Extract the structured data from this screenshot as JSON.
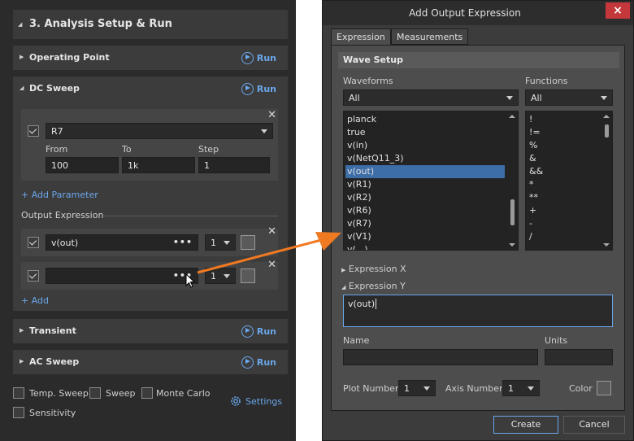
{
  "left": {
    "section_title": "3. Analysis Setup & Run",
    "run_label": "Run",
    "operating_point": {
      "title": "Operating Point"
    },
    "dc_sweep": {
      "title": "DC Sweep",
      "source_value": "R7",
      "from_label": "From",
      "to_label": "To",
      "step_label": "Step",
      "from_value": "100",
      "to_value": "1k",
      "step_value": "1",
      "add_parameter": "+ Add Parameter",
      "output_expression_label": "Output Expression",
      "expr1_value": "v(out)",
      "expr1_plot": "1",
      "expr2_value": "",
      "expr2_plot": "1",
      "add_label": "+ Add",
      "dots": "•••"
    },
    "transient": {
      "title": "Transient"
    },
    "ac_sweep": {
      "title": "AC Sweep"
    },
    "options": {
      "temp_sweep": "Temp. Sweep",
      "sweep": "Sweep",
      "monte_carlo": "Monte Carlo",
      "sensitivity": "Sensitivity",
      "settings": "Settings"
    }
  },
  "dialog": {
    "title": "Add Output Expression",
    "close": "×",
    "tabs": [
      "Expression",
      "Measurements"
    ],
    "wave_setup": "Wave Setup",
    "waveforms_label": "Waveforms",
    "waveforms_filter": "All",
    "functions_label": "Functions",
    "functions_filter": "All",
    "waveforms": [
      "planck",
      "true",
      "v(in)",
      "v(NetQ11_3)",
      "v(out)",
      "v(R1)",
      "v(R2)",
      "v(R6)",
      "v(R7)",
      "v(V1)",
      "v(...)"
    ],
    "selected_waveform": "v(out)",
    "functions": [
      "!",
      "!=",
      "%",
      "&",
      "&&",
      "*",
      "**",
      "+",
      "-",
      "/",
      "..."
    ],
    "expression_x": "Expression X",
    "expression_y": "Expression Y",
    "expression_y_value": "v(out)",
    "name_label": "Name",
    "units_label": "Units",
    "name_value": "",
    "units_value": "",
    "plot_number_label": "Plot Number",
    "plot_number_value": "1",
    "axis_number_label": "Axis Number",
    "axis_number_value": "1",
    "color_label": "Color",
    "create": "Create",
    "cancel": "Cancel"
  },
  "colors": {
    "accent": "#6aa7ec",
    "arrow": "#f07a22",
    "selection": "#3d6ea8",
    "close": "#c4373a"
  }
}
